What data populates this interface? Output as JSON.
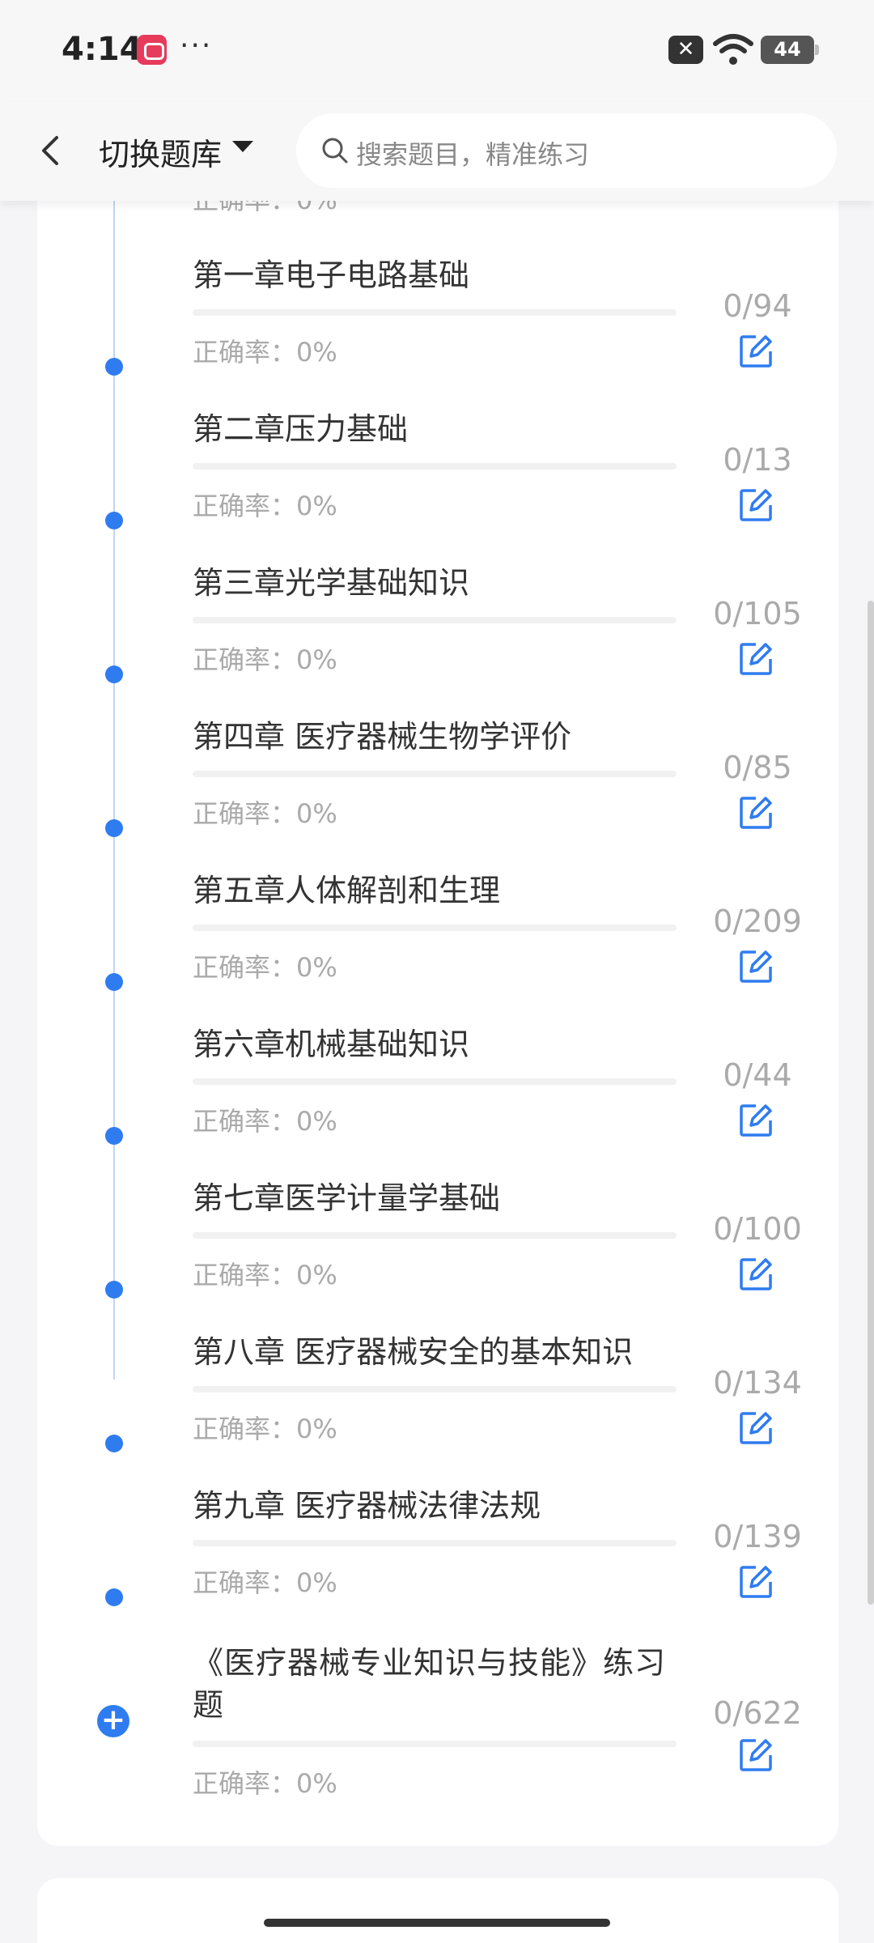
{
  "status": {
    "time": "4:14",
    "dots": "···",
    "battery": "44"
  },
  "header": {
    "switch_label": "切换题库",
    "search_placeholder": "搜索题目，精准练习"
  },
  "peek_accuracy": "正确率：0%",
  "chapters": [
    {
      "title": "第一章电子电路基础",
      "count": "0/94",
      "accuracy": "正确率：0%"
    },
    {
      "title": "第二章压力基础",
      "count": "0/13",
      "accuracy": "正确率：0%"
    },
    {
      "title": "第三章光学基础知识",
      "count": "0/105",
      "accuracy": "正确率：0%"
    },
    {
      "title": "第四章 医疗器械生物学评价",
      "count": "0/85",
      "accuracy": "正确率：0%"
    },
    {
      "title": "第五章人体解剖和生理",
      "count": "0/209",
      "accuracy": "正确率：0%"
    },
    {
      "title": "第六章机械基础知识",
      "count": "0/44",
      "accuracy": "正确率：0%"
    },
    {
      "title": "第七章医学计量学基础",
      "count": "0/100",
      "accuracy": "正确率：0%"
    },
    {
      "title": "第八章 医疗器械安全的基本知识",
      "count": "0/134",
      "accuracy": "正确率：0%"
    },
    {
      "title": "第九章 医疗器械法律法规",
      "count": "0/139",
      "accuracy": "正确率：0%"
    },
    {
      "title": "《医疗器械专业知识与技能》练习题",
      "count": "0/622",
      "accuracy": "正确率：0%"
    }
  ],
  "colors": {
    "accent": "#2f7cf0",
    "muted": "#aaaaaa"
  }
}
